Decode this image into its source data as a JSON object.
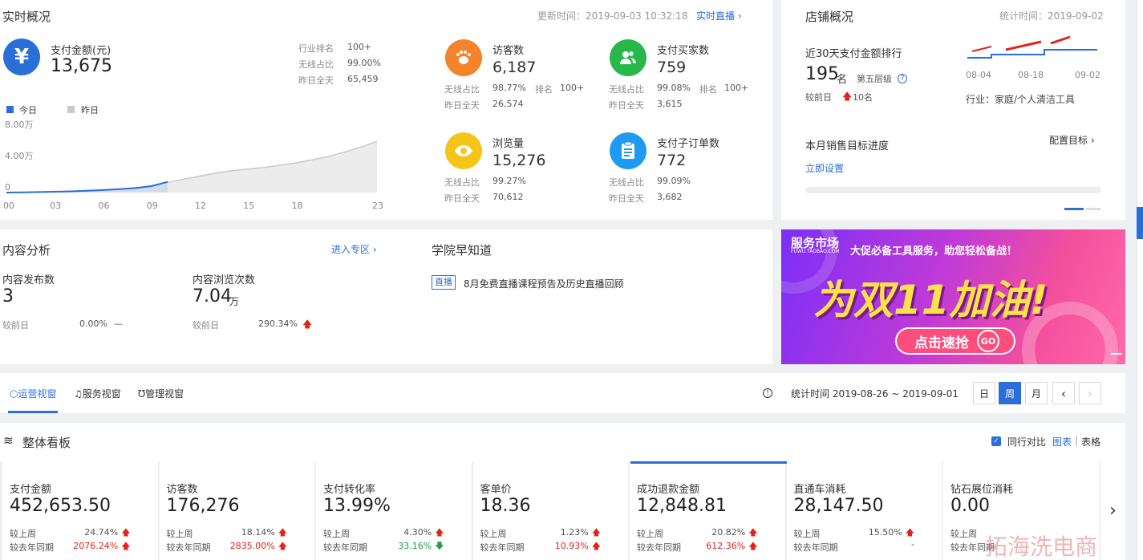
{
  "realtime": {
    "title": "实时概况",
    "update_time": "更新时间：2019-09-03 10:32:18",
    "live_link": "实时直播",
    "pay": {
      "label": "支付金额(元)",
      "value": "13,675",
      "rows": [
        {
          "label": "行业排名",
          "value": "100+"
        },
        {
          "label": "无线占比",
          "value": "99.00%"
        },
        {
          "label": "昨日全天",
          "value": "65,459"
        }
      ]
    },
    "legend": {
      "today": "今日",
      "yesterday": "昨日"
    },
    "chart_data": {
      "type": "area",
      "yticks": [
        "8.00万",
        "4.00万",
        "0"
      ],
      "xticks": [
        "00",
        "03",
        "06",
        "09",
        "12",
        "15",
        "18",
        "23"
      ],
      "ylim": [
        0,
        80000
      ],
      "series": [
        {
          "name": "今日",
          "x": [
            0,
            1,
            2,
            3,
            4,
            5,
            6,
            7,
            8,
            9,
            10
          ],
          "values": [
            0,
            300,
            600,
            1000,
            1500,
            2300,
            3200,
            4300,
            5800,
            8200,
            13675
          ]
        },
        {
          "name": "昨日",
          "x": [
            0,
            1,
            2,
            3,
            4,
            5,
            6,
            7,
            8,
            9,
            10,
            11,
            12,
            13,
            14,
            15,
            16,
            17,
            18,
            19,
            20,
            21,
            22,
            23
          ],
          "values": [
            0,
            300,
            600,
            1000,
            1500,
            2300,
            3200,
            4300,
            5800,
            8500,
            13000,
            17000,
            21000,
            25000,
            28000,
            30000,
            32000,
            35000,
            38000,
            42000,
            46000,
            52000,
            58000,
            65459
          ]
        }
      ]
    },
    "metrics": [
      {
        "label": "访客数",
        "value": "6,187",
        "r1": "无线占比",
        "r1v": "98.77%",
        "rank_label": "排名",
        "rank": "100+",
        "r2": "昨日全天",
        "r2v": "26,574",
        "color": "#f5832b"
      },
      {
        "label": "支付买家数",
        "value": "759",
        "r1": "无线占比",
        "r1v": "99.08%",
        "rank_label": "排名",
        "rank": "100+",
        "r2": "昨日全天",
        "r2v": "3,615",
        "color": "#27b74a"
      },
      {
        "label": "浏览量",
        "value": "15,276",
        "r1": "无线占比",
        "r1v": "99.27%",
        "rank_label": "",
        "rank": "",
        "r2": "昨日全天",
        "r2v": "70,612",
        "color": "#f5c518"
      },
      {
        "label": "支付子订单数",
        "value": "772",
        "r1": "无线占比",
        "r1v": "99.09%",
        "rank_label": "",
        "rank": "",
        "r2": "昨日全天",
        "r2v": "3,682",
        "color": "#1e9bf0"
      }
    ]
  },
  "shop": {
    "title": "店铺概况",
    "stat_time": "统计时间：2019-09-02",
    "rank_title": "近30天支付金额排行",
    "rank": "195",
    "rank_unit": "名",
    "tier": "第五层级",
    "compare_label": "较前日",
    "compare_value": "10名",
    "dates": [
      "08-04",
      "08-18",
      "09-02"
    ],
    "industry": "行业：家庭/个人清洁工具",
    "goal_title": "本月销售目标进度",
    "goal_config": "配置目标",
    "goal_set": "立即设置"
  },
  "content": {
    "title": "内容分析",
    "enter": "进入专区",
    "pub_label": "内容发布数",
    "pub_value": "3",
    "pub_cmp_label": "较前日",
    "pub_cmp_value": "0.00%",
    "pub_cmp_sign": "—",
    "view_label": "内容浏览次数",
    "view_value": "7.04",
    "view_unit": "万",
    "view_cmp_label": "较前日",
    "view_cmp_value": "290.34%"
  },
  "academy": {
    "title": "学院早知道",
    "tag": "直播",
    "text": "8月免费直播课程预告及历史直播回顾"
  },
  "banner": {
    "brand": "服务市场",
    "brand_sub": "FUWU.TAOBAO.COM",
    "slogan": "大促必备工具服务，助您轻松备战！",
    "headline": "为双11加油!",
    "cta": "点击速抢",
    "go": "GO"
  },
  "tabs": {
    "items": [
      "运营视窗",
      "服务视窗",
      "管理视窗"
    ],
    "stat_time": "统计时间 2019-08-26 ~ 2019-09-01",
    "periods": [
      "日",
      "周",
      "月"
    ],
    "prev": "‹",
    "next": "›"
  },
  "board": {
    "title": "整体看板",
    "peer": "同行对比",
    "chart": "图表",
    "sep": "|",
    "table": "表格",
    "cards": [
      {
        "label": "支付金额",
        "value": "452,653.50",
        "w_label": "较上周",
        "w_value": "24.74%",
        "w_dir": "up",
        "y_label": "较去年同期",
        "y_value": "2076.24%",
        "y_dir": "up"
      },
      {
        "label": "访客数",
        "value": "176,276",
        "w_label": "较上周",
        "w_value": "18.14%",
        "w_dir": "up",
        "y_label": "较去年同期",
        "y_value": "2835.00%",
        "y_dir": "up"
      },
      {
        "label": "支付转化率",
        "value": "13.99%",
        "w_label": "较上周",
        "w_value": "4.30%",
        "w_dir": "up",
        "y_label": "较去年同期",
        "y_value": "33.16%",
        "y_dir": "down"
      },
      {
        "label": "客单价",
        "value": "18.36",
        "w_label": "较上周",
        "w_value": "1.23%",
        "w_dir": "up",
        "y_label": "较去年同期",
        "y_value": "10.93%",
        "y_dir": "up"
      },
      {
        "label": "成功退款金额",
        "value": "12,848.81",
        "w_label": "较上周",
        "w_value": "20.82%",
        "w_dir": "up",
        "y_label": "较去年同期",
        "y_value": "612.36%",
        "y_dir": "up"
      },
      {
        "label": "直通车消耗",
        "value": "28,147.50",
        "w_label": "较上周",
        "w_value": "15.50%",
        "w_dir": "up",
        "y_label": "较去年同期",
        "y_value": "-",
        "y_dir": ""
      },
      {
        "label": "钻石展位消耗",
        "value": "0.00",
        "w_label": "较上周",
        "w_value": "",
        "w_dir": "",
        "y_label": "较去年同期",
        "y_value": "",
        "y_dir": ""
      }
    ]
  },
  "watermark": "拓海洗电商"
}
